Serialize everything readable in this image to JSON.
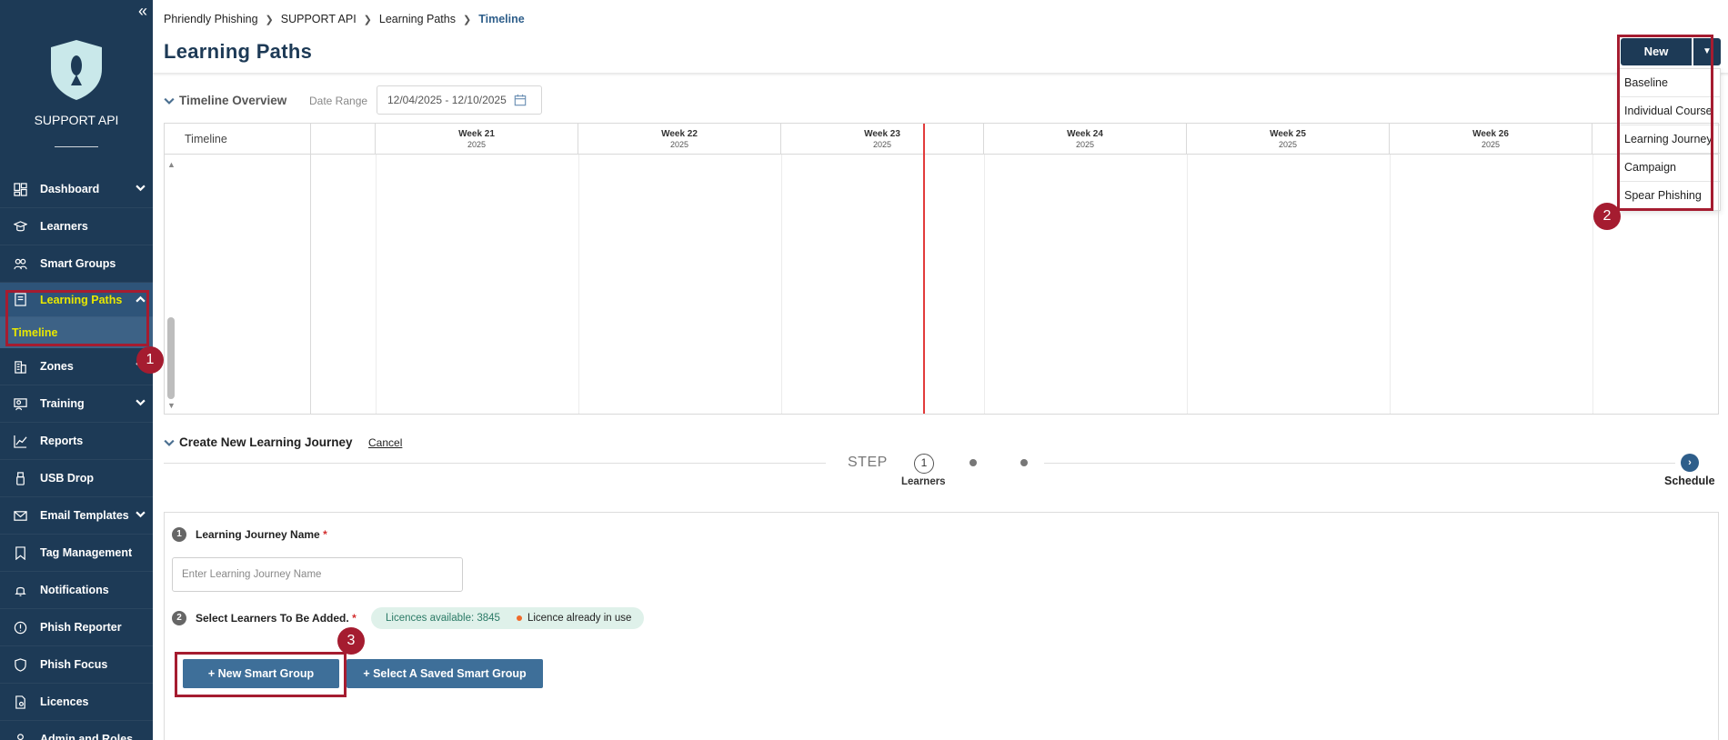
{
  "sidebar": {
    "org_name": "SUPPORT API",
    "items": [
      {
        "label": "Dashboard",
        "icon": "dashboard-icon",
        "has_chevron": true
      },
      {
        "label": "Learners",
        "icon": "learners-icon",
        "has_chevron": false
      },
      {
        "label": "Smart Groups",
        "icon": "users-icon",
        "has_chevron": false
      },
      {
        "label": "Learning Paths",
        "icon": "book-icon",
        "has_chevron": true,
        "active": true
      },
      {
        "label": "Zones",
        "icon": "building-icon",
        "has_chevron": true
      },
      {
        "label": "Training",
        "icon": "training-icon",
        "has_chevron": true
      },
      {
        "label": "Reports",
        "icon": "chart-icon",
        "has_chevron": false
      },
      {
        "label": "USB Drop",
        "icon": "usb-icon",
        "has_chevron": false
      },
      {
        "label": "Email Templates",
        "icon": "envelope-icon",
        "has_chevron": true
      },
      {
        "label": "Tag Management",
        "icon": "bookmark-icon",
        "has_chevron": false
      },
      {
        "label": "Notifications",
        "icon": "bell-icon",
        "has_chevron": false
      },
      {
        "label": "Phish Reporter",
        "icon": "alert-icon",
        "has_chevron": false
      },
      {
        "label": "Phish Focus",
        "icon": "shield-icon",
        "has_chevron": false
      },
      {
        "label": "Licences",
        "icon": "licence-icon",
        "has_chevron": false
      },
      {
        "label": "Admin and Roles",
        "icon": "admin-icon",
        "has_chevron": false
      }
    ],
    "sub_item": "Timeline"
  },
  "breadcrumb": [
    "Phriendly Phishing",
    "SUPPORT API",
    "Learning Paths",
    "Timeline"
  ],
  "page_title": "Learning Paths",
  "new_button": {
    "label": "New",
    "options": [
      "Baseline",
      "Individual Course",
      "Learning Journey",
      "Campaign",
      "Spear Phishing"
    ]
  },
  "timeline": {
    "heading": "Timeline Overview",
    "date_range_label": "Date Range",
    "date_range_value": "12/04/2025 - 12/10/2025",
    "column_label": "Timeline",
    "weeks": [
      {
        "week": "Week 21",
        "year": "2025"
      },
      {
        "week": "Week 22",
        "year": "2025"
      },
      {
        "week": "Week 23",
        "year": "2025"
      },
      {
        "week": "Week 24",
        "year": "2025"
      },
      {
        "week": "Week 25",
        "year": "2025"
      },
      {
        "week": "Week 26",
        "year": "2025"
      }
    ]
  },
  "create_journey": {
    "heading": "Create New Learning Journey",
    "cancel": "Cancel",
    "step_label": "STEP",
    "current_step": "1",
    "current_step_name": "Learners",
    "final_step_name": "Schedule",
    "field1_num": "1",
    "field1_label": "Learning Journey Name",
    "field1_placeholder": "Enter Learning Journey Name",
    "field2_num": "2",
    "field2_label": "Select Learners To Be Added.",
    "required_mark": "*",
    "licences_available": "Licences available: 3845",
    "licence_in_use": "Licence already in use",
    "new_smart_group": "+ New Smart Group",
    "select_saved_group": "+ Select A Saved Smart Group"
  },
  "annotations": [
    "1",
    "2",
    "3"
  ],
  "colors": {
    "sidebar_bg": "#1d3a56",
    "active_text": "#e8e800",
    "highlight": "#a51c30",
    "today_line": "#e23b3b",
    "primary_button": "#3e6f99"
  }
}
